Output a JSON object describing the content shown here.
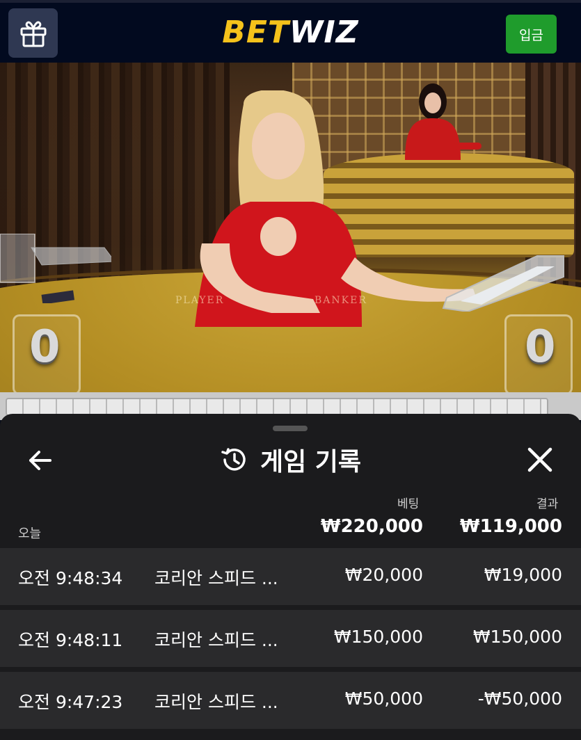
{
  "header": {
    "logo_part1": "BET",
    "logo_part2": "WIZ",
    "deposit_label": "입금",
    "icon": "gift-icon"
  },
  "video": {
    "player_label": "PLAYER",
    "banker_label": "BANKER",
    "player_score": "0",
    "banker_score": "0"
  },
  "history": {
    "title": "게임 기록",
    "back_icon": "arrow-left-icon",
    "title_icon": "history-icon",
    "close_icon": "close-icon",
    "col_bet": "베팅",
    "col_result": "결과",
    "today_label": "오늘",
    "total_bet": "₩220,000",
    "total_result": "₩119,000",
    "rows": [
      {
        "time": "오전 9:48:34",
        "game": "코리안 스피드 ...",
        "bet": "₩20,000",
        "result": "₩19,000"
      },
      {
        "time": "오전 9:48:11",
        "game": "코리안 스피드 ...",
        "bet": "₩150,000",
        "result": "₩150,000"
      },
      {
        "time": "오전 9:47:23",
        "game": "코리안 스피드 ...",
        "bet": "₩50,000",
        "result": "-₩50,000"
      }
    ]
  },
  "colors": {
    "brand_yellow": "#f5c21b",
    "deposit_green": "#1f9c2c",
    "panel_bg": "#1b1b1d",
    "row_bg": "#2a2a2c"
  }
}
